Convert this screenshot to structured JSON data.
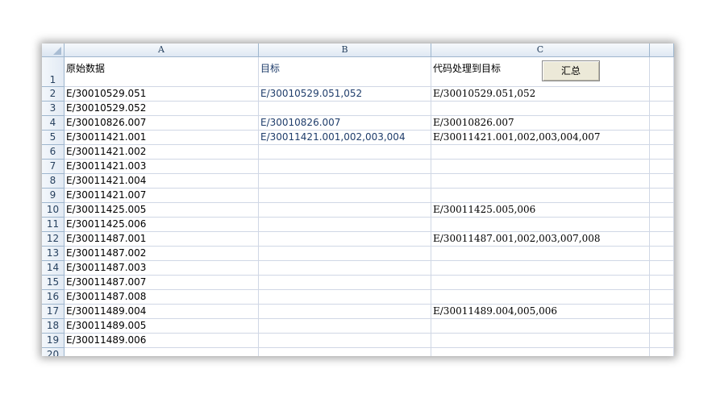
{
  "sheet": {
    "columns": [
      "A",
      "B",
      "C"
    ],
    "row_numbers": [
      "1",
      "2",
      "3",
      "4",
      "5",
      "6",
      "7",
      "8",
      "9",
      "10",
      "11",
      "12",
      "13",
      "14",
      "15",
      "16",
      "17",
      "18",
      "19",
      "20"
    ],
    "col_a": [
      "原始数据",
      "E/30010529.051",
      "E/30010529.052",
      "E/30010826.007",
      "E/30011421.001",
      "E/30011421.002",
      "E/30011421.003",
      "E/30011421.004",
      "E/30011421.007",
      "E/30011425.005",
      "E/30011425.006",
      "E/30011487.001",
      "E/30011487.002",
      "E/30011487.003",
      "E/30011487.007",
      "E/30011487.008",
      "E/30011489.004",
      "E/30011489.005",
      "E/30011489.006",
      ""
    ],
    "col_b": [
      "目标",
      "E/30010529.051,052",
      "",
      "E/30010826.007",
      "E/30011421.001,002,003,004",
      "",
      "",
      "",
      "",
      "",
      "",
      "",
      "",
      "",
      "",
      "",
      "",
      "",
      "",
      ""
    ],
    "col_c": [
      "代码处理到目标",
      "E/30010529.051,052",
      "",
      "E/30010826.007",
      "E/30011421.001,002,003,004,007",
      "",
      "",
      "",
      "",
      "E/30011425.005,006",
      "",
      "E/30011487.001,002,003,007,008",
      "",
      "",
      "",
      "",
      "E/30011489.004,005,006",
      "",
      "",
      ""
    ],
    "button_label": "汇总"
  }
}
